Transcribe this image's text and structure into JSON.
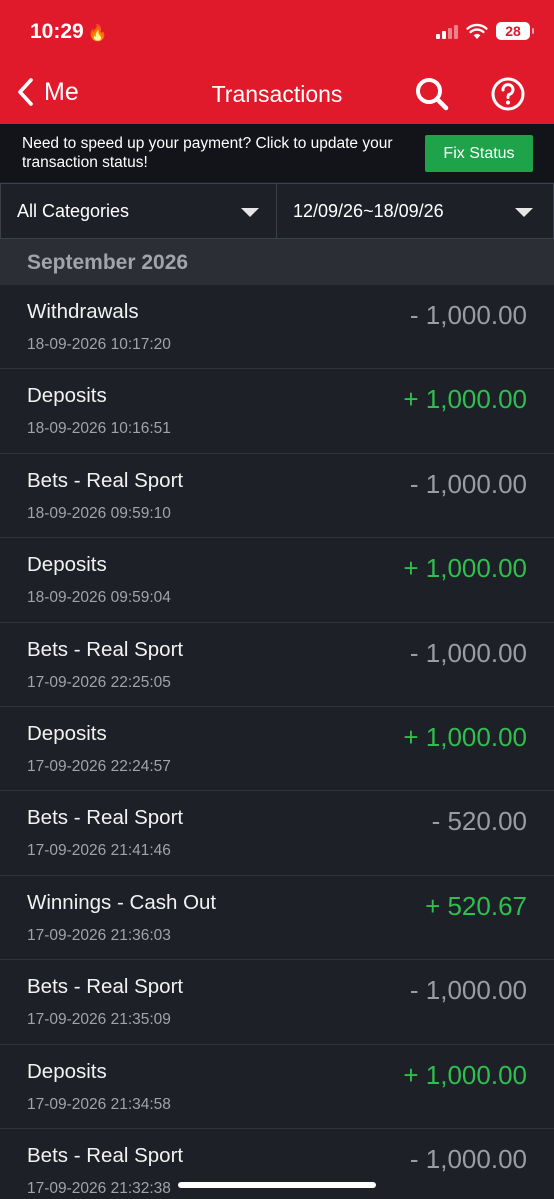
{
  "status_bar": {
    "time": "10:29",
    "battery": "28"
  },
  "nav": {
    "back_label": "Me",
    "title": "Transactions"
  },
  "banner": {
    "message": "Need to speed up your payment? Click to update your transaction status!",
    "button_label": "Fix Status"
  },
  "filters": {
    "category": "All Categories",
    "date_range": "12/09/26~18/09/26"
  },
  "month_header": "September 2026",
  "transactions": [
    {
      "category": "Withdrawals",
      "timestamp": "18-09-2026 10:17:20",
      "amount": "- 1,000.00",
      "type": "debit"
    },
    {
      "category": "Deposits",
      "timestamp": "18-09-2026 10:16:51",
      "amount": "+ 1,000.00",
      "type": "credit"
    },
    {
      "category": "Bets - Real Sport",
      "timestamp": "18-09-2026 09:59:10",
      "amount": "- 1,000.00",
      "type": "debit"
    },
    {
      "category": "Deposits",
      "timestamp": "18-09-2026 09:59:04",
      "amount": "+ 1,000.00",
      "type": "credit"
    },
    {
      "category": "Bets - Real Sport",
      "timestamp": "17-09-2026 22:25:05",
      "amount": "- 1,000.00",
      "type": "debit"
    },
    {
      "category": "Deposits",
      "timestamp": "17-09-2026 22:24:57",
      "amount": "+ 1,000.00",
      "type": "credit"
    },
    {
      "category": "Bets - Real Sport",
      "timestamp": "17-09-2026 21:41:46",
      "amount": "- 520.00",
      "type": "debit"
    },
    {
      "category": "Winnings - Cash Out",
      "timestamp": "17-09-2026 21:36:03",
      "amount": "+ 520.67",
      "type": "credit"
    },
    {
      "category": "Bets - Real Sport",
      "timestamp": "17-09-2026 21:35:09",
      "amount": "- 1,000.00",
      "type": "debit"
    },
    {
      "category": "Deposits",
      "timestamp": "17-09-2026 21:34:58",
      "amount": "+ 1,000.00",
      "type": "credit"
    },
    {
      "category": "Bets - Real Sport",
      "timestamp": "17-09-2026 21:32:38",
      "amount": "- 1,000.00",
      "type": "debit"
    }
  ],
  "colors": {
    "brand_red": "#e01a2b",
    "credit_green": "#2fbf4e",
    "debit_grey": "#9a9da4",
    "button_green": "#1ea34a"
  },
  "icons": [
    "flame-icon",
    "signal-icon",
    "wifi-icon",
    "battery-icon",
    "chevron-left-icon",
    "search-icon",
    "help-icon",
    "caret-down-icon"
  ]
}
